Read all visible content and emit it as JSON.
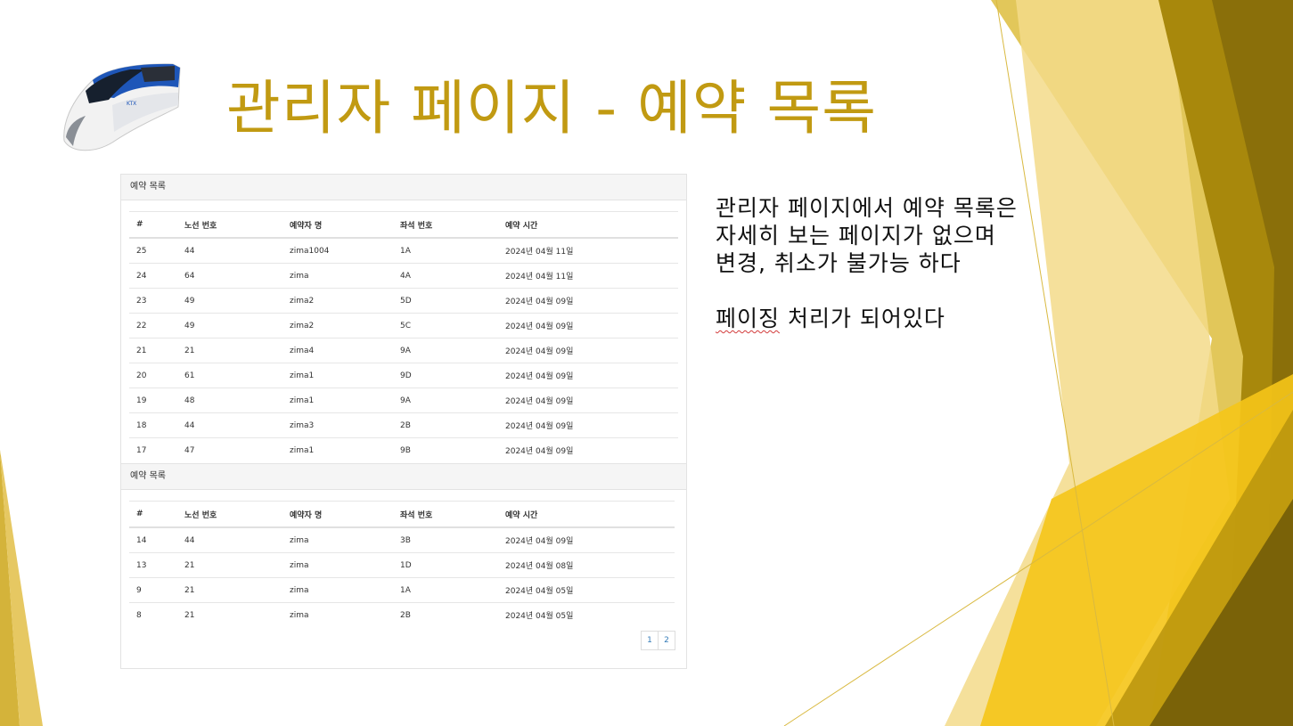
{
  "slide": {
    "title": "관리자 페이지 - 예약 목록",
    "description_lines": [
      "관리자 페이지에서 예약 목록은",
      "자세히 보는 페이지가 없으며",
      "변경, 취소가 불가능 하다"
    ],
    "note_underlined": "페이징",
    "note_rest": " 처리가 되어있다",
    "colors": {
      "title": "#c19a12",
      "accent_gold": "#d9b940",
      "dark_gold": "#8a6f0a"
    }
  },
  "panel_1": {
    "heading": "예약 목록",
    "columns": [
      "#",
      "노선 번호",
      "예약자 명",
      "좌석 번호",
      "예약 시간"
    ],
    "rows": [
      [
        "25",
        "44",
        "zima1004",
        "1A",
        "2024년 04월 11일"
      ],
      [
        "24",
        "64",
        "zima",
        "4A",
        "2024년 04월 11일"
      ],
      [
        "23",
        "49",
        "zima2",
        "5D",
        "2024년 04월 09일"
      ],
      [
        "22",
        "49",
        "zima2",
        "5C",
        "2024년 04월 09일"
      ],
      [
        "21",
        "21",
        "zima4",
        "9A",
        "2024년 04월 09일"
      ],
      [
        "20",
        "61",
        "zima1",
        "9D",
        "2024년 04월 09일"
      ],
      [
        "19",
        "48",
        "zima1",
        "9A",
        "2024년 04월 09일"
      ],
      [
        "18",
        "44",
        "zima3",
        "2B",
        "2024년 04월 09일"
      ],
      [
        "17",
        "47",
        "zima1",
        "9B",
        "2024년 04월 09일"
      ]
    ]
  },
  "panel_2": {
    "heading": "예약 목록",
    "columns": [
      "#",
      "노선 번호",
      "예약자 명",
      "좌석 번호",
      "예약 시간"
    ],
    "rows": [
      [
        "14",
        "44",
        "zima",
        "3B",
        "2024년 04월 09일"
      ],
      [
        "13",
        "21",
        "zima",
        "1D",
        "2024년 04월 08일"
      ],
      [
        "9",
        "21",
        "zima",
        "1A",
        "2024년 04월 05일"
      ],
      [
        "8",
        "21",
        "zima",
        "2B",
        "2024년 04월 05일"
      ]
    ],
    "pagination": [
      "1",
      "2"
    ]
  },
  "icons": {
    "logo": "train-icon"
  }
}
